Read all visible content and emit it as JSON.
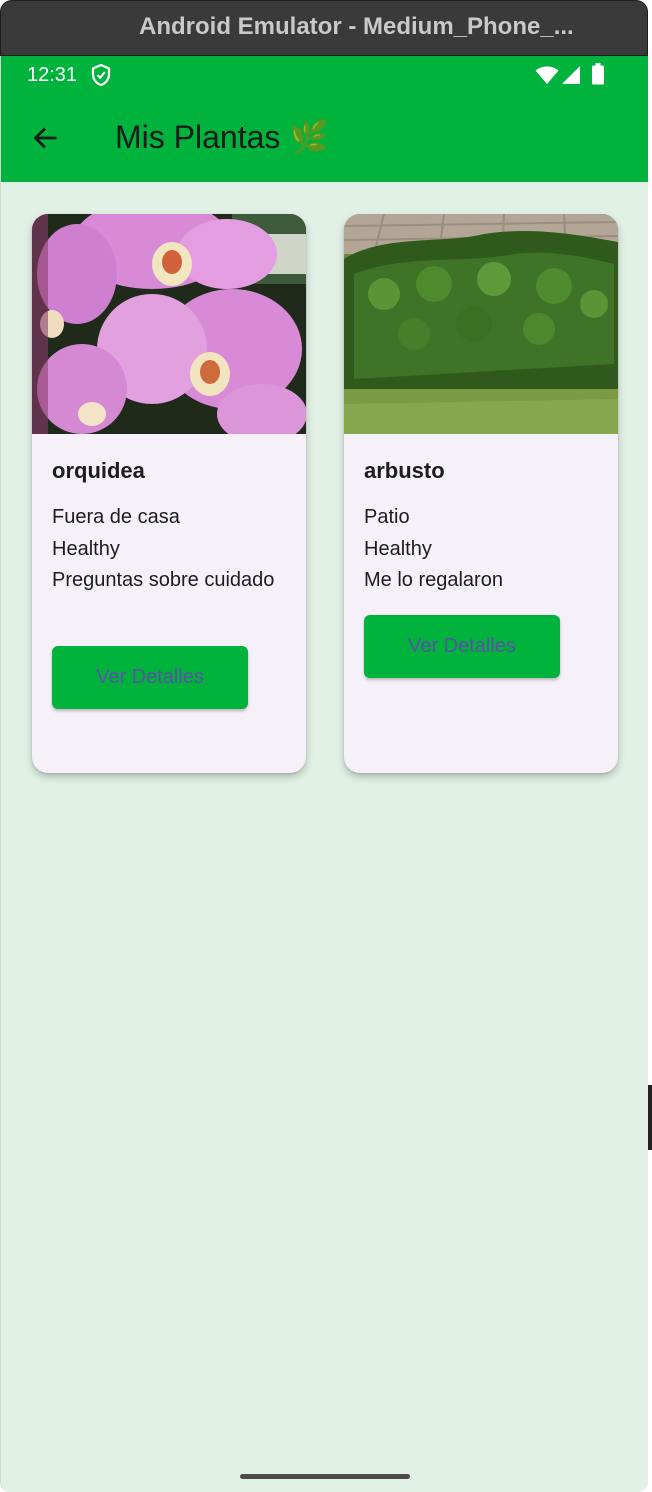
{
  "window": {
    "title": "Android Emulator - Medium_Phone_..."
  },
  "status_bar": {
    "time": "12:31",
    "icons": [
      "shield-icon",
      "wifi-icon",
      "signal-icon",
      "battery-icon"
    ]
  },
  "app_bar": {
    "title": "Mis Plantas 🌿",
    "back_icon": "arrow-left-icon"
  },
  "colors": {
    "primary": "#00b33d",
    "background": "#e1f1e5",
    "card": "#f6f1f9",
    "button_text": "#5b51a8"
  },
  "plants": [
    {
      "name": "orquidea",
      "location": "Fuera de casa",
      "status": "Healthy",
      "note": "Preguntas sobre cuidado",
      "button": "Ver Detalles",
      "image": "orchid-photo"
    },
    {
      "name": "arbusto",
      "location": "Patio",
      "status": "Healthy",
      "note": "Me lo regalaron",
      "button": "Ver Detalles",
      "image": "shrub-photo"
    }
  ]
}
